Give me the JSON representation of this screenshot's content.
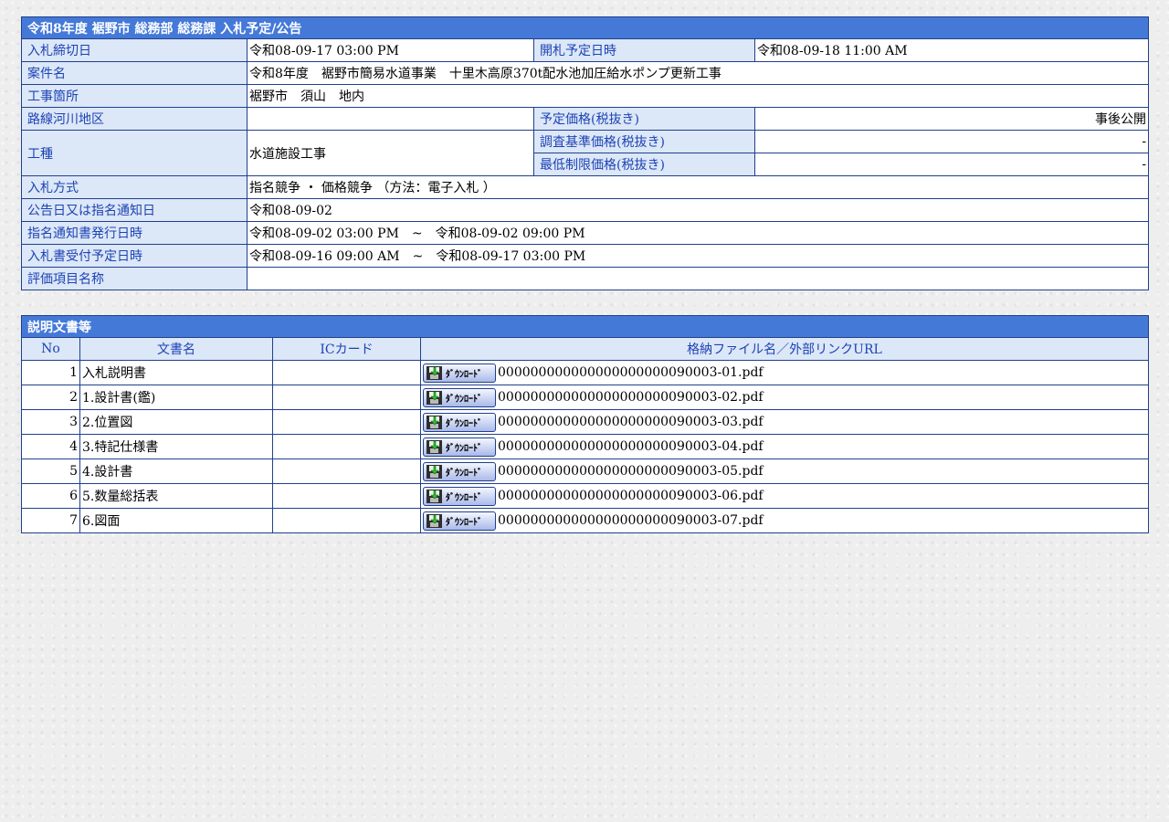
{
  "info": {
    "caption": "令和8年度 裾野市 総務部 総務課 入札予定/公告",
    "rows": {
      "deadline": {
        "label": "入札締切日",
        "value": "令和08-09-17 03:00 PM"
      },
      "opening": {
        "label": "開札予定日時",
        "value": "令和08-09-18 11:00 AM"
      },
      "project": {
        "label": "案件名",
        "value": "令和8年度　裾野市簡易水道事業　十里木高原370t配水池加圧給水ポンプ更新工事"
      },
      "location": {
        "label": "工事箇所",
        "value": "裾野市　須山　地内"
      },
      "route": {
        "label": "路線河川地区",
        "value": ""
      },
      "planned_price": {
        "label": "予定価格(税抜き)",
        "value": "事後公開"
      },
      "work_type": {
        "label": "工種",
        "value": "水道施設工事"
      },
      "survey_price": {
        "label": "調査基準価格(税抜き)",
        "value": "-"
      },
      "min_price": {
        "label": "最低制限価格(税抜き)",
        "value": "-"
      },
      "method": {
        "label": "入札方式",
        "value": "指名競争 ・ 価格競争 （方法：電子入札 ）"
      },
      "notice_date": {
        "label": "公告日又は指名通知日",
        "value": "令和08-09-02"
      },
      "nomination_issue": {
        "label": "指名通知書発行日時",
        "value": "令和08-09-02 03:00 PM　~　令和08-09-02 09:00 PM"
      },
      "bid_reception": {
        "label": "入札書受付予定日時",
        "value": "令和08-09-16 09:00 AM　~　令和08-09-17 03:00 PM"
      },
      "evaluation": {
        "label": "評価項目名称",
        "value": ""
      }
    }
  },
  "docs": {
    "caption": "説明文書等",
    "headers": {
      "no": "No",
      "name": "文書名",
      "ic": "ICカード",
      "file": "格納ファイル名／外部リンクURL"
    },
    "download_label": "ﾀﾞｳﾝﾛｰﾄﾞ",
    "rows": [
      {
        "no": "1",
        "name": "入札説明書",
        "ic": "",
        "file": "000000000000000000000090003-01.pdf"
      },
      {
        "no": "2",
        "name": "1.設計書(鑑)",
        "ic": "",
        "file": "000000000000000000000090003-02.pdf"
      },
      {
        "no": "3",
        "name": "2.位置図",
        "ic": "",
        "file": "000000000000000000000090003-03.pdf"
      },
      {
        "no": "4",
        "name": "3.特記仕様書",
        "ic": "",
        "file": "000000000000000000000090003-04.pdf"
      },
      {
        "no": "5",
        "name": "4.設計書",
        "ic": "",
        "file": "000000000000000000000090003-05.pdf"
      },
      {
        "no": "6",
        "name": "5.数量総括表",
        "ic": "",
        "file": "000000000000000000000090003-06.pdf"
      },
      {
        "no": "7",
        "name": "6.図面",
        "ic": "",
        "file": "000000000000000000000090003-07.pdf"
      }
    ]
  },
  "colors": {
    "caption_bg": "#4479d8",
    "label_bg": "#dce7f7",
    "label_text": "#1d43b4",
    "border": "#20408c"
  },
  "icons": {
    "download": "floppy-disk-icon"
  }
}
